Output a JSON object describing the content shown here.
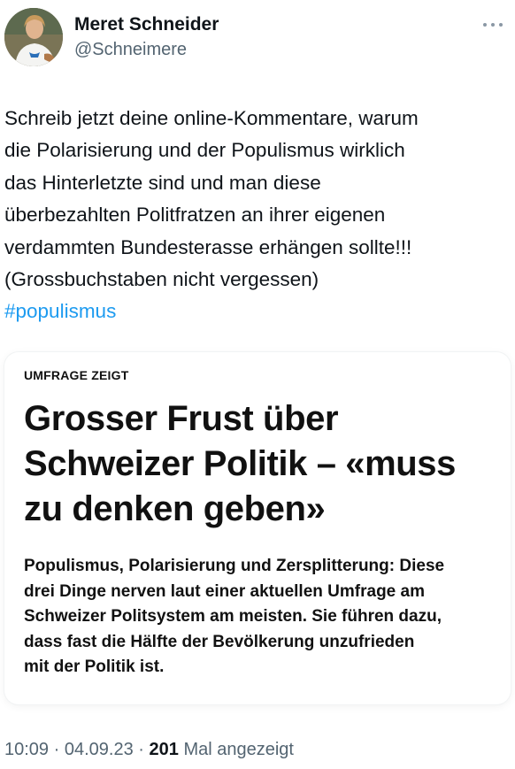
{
  "author": {
    "display_name": "Meret Schneider",
    "handle": "@Schneimere"
  },
  "tweet": {
    "text_lines": [
      "Schreib jetzt deine online-Kommentare, warum",
      "die Polarisierung und der Populismus wirklich",
      "das Hinterletzte sind und man diese",
      "überbezahlten Politfratzen an ihrer eigenen",
      "verdammten Bundesterasse erhängen sollte!!!",
      "(Grossbuchstaben nicht vergessen)"
    ],
    "hashtag": "#populismus"
  },
  "card": {
    "kicker": "UMFRAGE ZEIGT",
    "headline_lines": [
      "Grosser Frust über",
      "Schweizer Politik – «muss",
      "zu denken geben»"
    ],
    "lead_lines": [
      "Populismus, Polarisierung und Zersplitterung: Diese",
      "drei Dinge nerven laut einer aktuellen Umfrage am",
      "Schweizer Politsystem am meisten. Sie führen dazu,",
      "dass fast die Hälfte der Bevölkerung unzufrieden",
      "mit der Politik ist."
    ]
  },
  "meta": {
    "time": "10:09",
    "separator": "·",
    "date": "04.09.23",
    "views_count": "201",
    "views_label": "Mal angezeigt"
  },
  "icons": {
    "more": "more-horizontal-icon"
  },
  "colors": {
    "text": "#0f1419",
    "secondary": "#536471",
    "link": "#1d9bf0"
  }
}
